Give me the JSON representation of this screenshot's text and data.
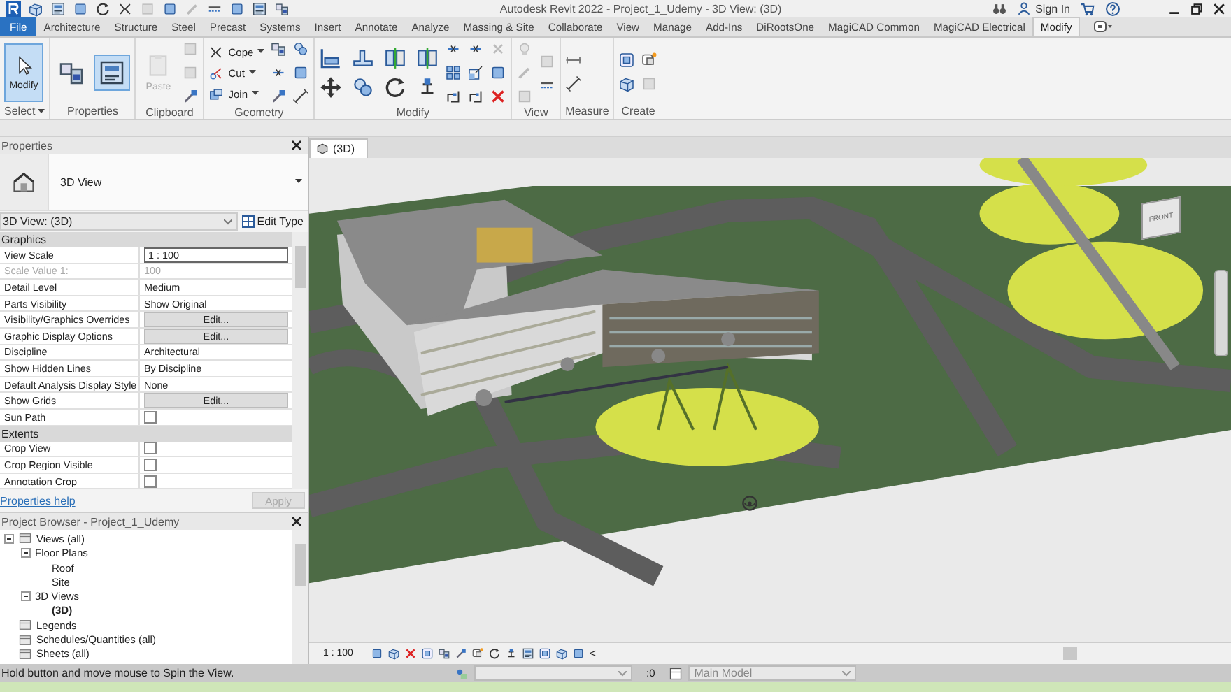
{
  "window": {
    "title": "Autodesk Revit 2022 - Project_1_Udemy - 3D View: (3D)",
    "sign_in": "Sign In"
  },
  "tabs": [
    {
      "label": "File",
      "kind": "file",
      "selected": false
    },
    {
      "label": "Architecture",
      "selected": false
    },
    {
      "label": "Structure",
      "selected": false
    },
    {
      "label": "Steel",
      "selected": false
    },
    {
      "label": "Precast",
      "selected": false
    },
    {
      "label": "Systems",
      "selected": false
    },
    {
      "label": "Insert",
      "selected": false
    },
    {
      "label": "Annotate",
      "selected": false
    },
    {
      "label": "Analyze",
      "selected": false
    },
    {
      "label": "Massing & Site",
      "selected": false
    },
    {
      "label": "Collaborate",
      "selected": false
    },
    {
      "label": "View",
      "selected": false
    },
    {
      "label": "Manage",
      "selected": false
    },
    {
      "label": "Add-Ins",
      "selected": false
    },
    {
      "label": "DiRootsOne",
      "selected": false
    },
    {
      "label": "MagiCAD Common",
      "selected": false
    },
    {
      "label": "MagiCAD Electrical",
      "selected": false
    },
    {
      "label": "Modify",
      "selected": true
    }
  ],
  "ribbon": [
    {
      "label": "Select",
      "kind": "select",
      "tools": [
        {
          "label": "Modify",
          "selected": true
        }
      ]
    },
    {
      "label": "Properties",
      "kind": "properties"
    },
    {
      "label": "Clipboard",
      "kind": "clipboard",
      "tools": [
        {
          "label": "Paste",
          "disabled": true
        }
      ]
    },
    {
      "label": "Geometry",
      "kind": "geometry",
      "tools": [
        {
          "label": "Cope",
          "disabled": false
        },
        {
          "label": "Cut",
          "disabled": false
        },
        {
          "label": "Join",
          "disabled": false
        }
      ]
    },
    {
      "label": "Modify",
      "kind": "modify"
    },
    {
      "label": "View",
      "kind": "view"
    },
    {
      "label": "Measure",
      "kind": "measure"
    },
    {
      "label": "Create",
      "kind": "create"
    }
  ],
  "properties": {
    "title": "Properties",
    "type_name": "3D View",
    "instance": "3D View: (3D)",
    "edit_type": "Edit Type",
    "groups": [
      {
        "name": "Graphics",
        "rows": [
          {
            "label": "View Scale",
            "kind": "field",
            "value": "1 : 100"
          },
          {
            "label": "Scale Value    1:",
            "kind": "text",
            "value": "100",
            "disabled": true
          },
          {
            "label": "Detail Level",
            "kind": "text",
            "value": "Medium",
            "disabled": false
          },
          {
            "label": "Parts Visibility",
            "kind": "text",
            "value": "Show Original",
            "disabled": false
          },
          {
            "label": "Visibility/Graphics Overrides",
            "kind": "button",
            "value": "Edit..."
          },
          {
            "label": "Graphic Display Options",
            "kind": "button",
            "value": "Edit..."
          },
          {
            "label": "Discipline",
            "kind": "text",
            "value": "Architectural",
            "disabled": false
          },
          {
            "label": "Show Hidden Lines",
            "kind": "text",
            "value": "By Discipline",
            "disabled": false
          },
          {
            "label": "Default Analysis Display Style",
            "kind": "text",
            "value": "None",
            "disabled": false
          },
          {
            "label": "Show Grids",
            "kind": "button",
            "value": "Edit..."
          },
          {
            "label": "Sun Path",
            "kind": "checkbox",
            "checked": false
          }
        ]
      },
      {
        "name": "Extents",
        "rows": [
          {
            "label": "Crop View",
            "kind": "checkbox",
            "checked": false
          },
          {
            "label": "Crop Region Visible",
            "kind": "checkbox",
            "checked": false
          },
          {
            "label": "Annotation Crop",
            "kind": "checkbox",
            "checked": false
          }
        ]
      }
    ],
    "help": "Properties help",
    "apply": {
      "label": "Apply",
      "disabled": true
    }
  },
  "project_browser": {
    "title": "Project Browser - Project_1_Udemy",
    "tree": [
      {
        "label": "Views (all)",
        "expanded": true,
        "selected": false,
        "children": [
          {
            "label": "Floor Plans",
            "expanded": true,
            "selected": false,
            "children": [
              {
                "label": "Roof",
                "selected": false
              },
              {
                "label": "Site",
                "selected": false
              }
            ]
          },
          {
            "label": "3D Views",
            "expanded": true,
            "selected": false,
            "children": [
              {
                "label": "(3D)",
                "selected": true
              }
            ]
          }
        ]
      },
      {
        "label": "Legends",
        "selected": false
      },
      {
        "label": "Schedules/Quantities (all)",
        "selected": false
      },
      {
        "label": "Sheets (all)",
        "selected": false
      }
    ]
  },
  "view_tab": {
    "label": "(3D)"
  },
  "viewcube": {
    "face": "FRONT"
  },
  "view_bar": {
    "scale": "1 : 100",
    "more": "<"
  },
  "status_bar": {
    "message": "Hold button and move mouse to Spin the View.",
    "offset": ":0",
    "model": "Main Model"
  }
}
